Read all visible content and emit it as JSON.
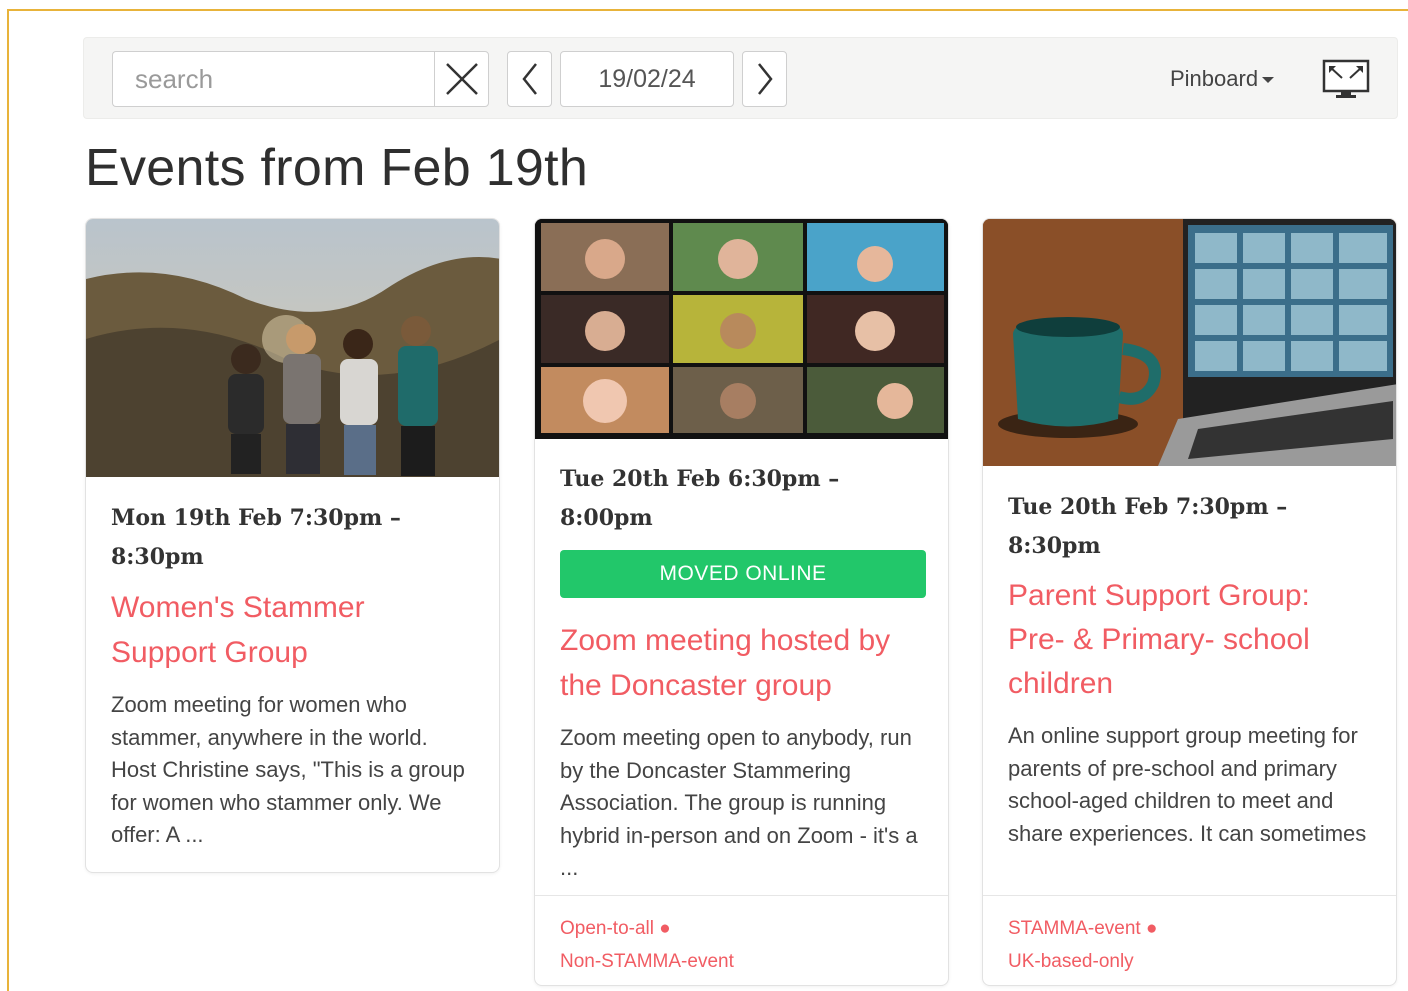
{
  "toolbar": {
    "search_placeholder": "search",
    "date": "19/02/24",
    "view_label": "Pinboard"
  },
  "page": {
    "title": "Events from Feb 19th"
  },
  "events": [
    {
      "time_line1": "Mon 19th Feb 7:30pm –",
      "time_line2": "8:30pm",
      "title": "Women's Stammer Support Group",
      "description": "Zoom meeting for women who stammer, anywhere in the world. Host Christine says, \"This is a group for women who stammer only. We offer: A ...",
      "badge": "",
      "tags": []
    },
    {
      "time_line1": "Tue 20th Feb 6:30pm –",
      "time_line2": "8:00pm",
      "title": "Zoom meeting hosted by the Doncaster group",
      "description": "Zoom meeting open to anybody, run by the Doncaster Stammering Association. The group is running hybrid in-person and on Zoom - it's a ...",
      "badge": "MOVED ONLINE",
      "tags": [
        "Open-to-all",
        "Non-STAMMA-event"
      ]
    },
    {
      "time_line1": "Tue 20th Feb 7:30pm –",
      "time_line2": "8:30pm",
      "title": "Parent Support Group: Pre- & Primary- school children",
      "description": "An online support group meeting for parents of pre-school and primary school-aged children to meet and share experiences. It can sometimes",
      "badge": "",
      "tags": [
        "STAMMA-event",
        "UK-based-only"
      ]
    }
  ],
  "colors": {
    "accent": "#f15c63",
    "badge": "#22c76a",
    "frame": "#e8b33a"
  }
}
